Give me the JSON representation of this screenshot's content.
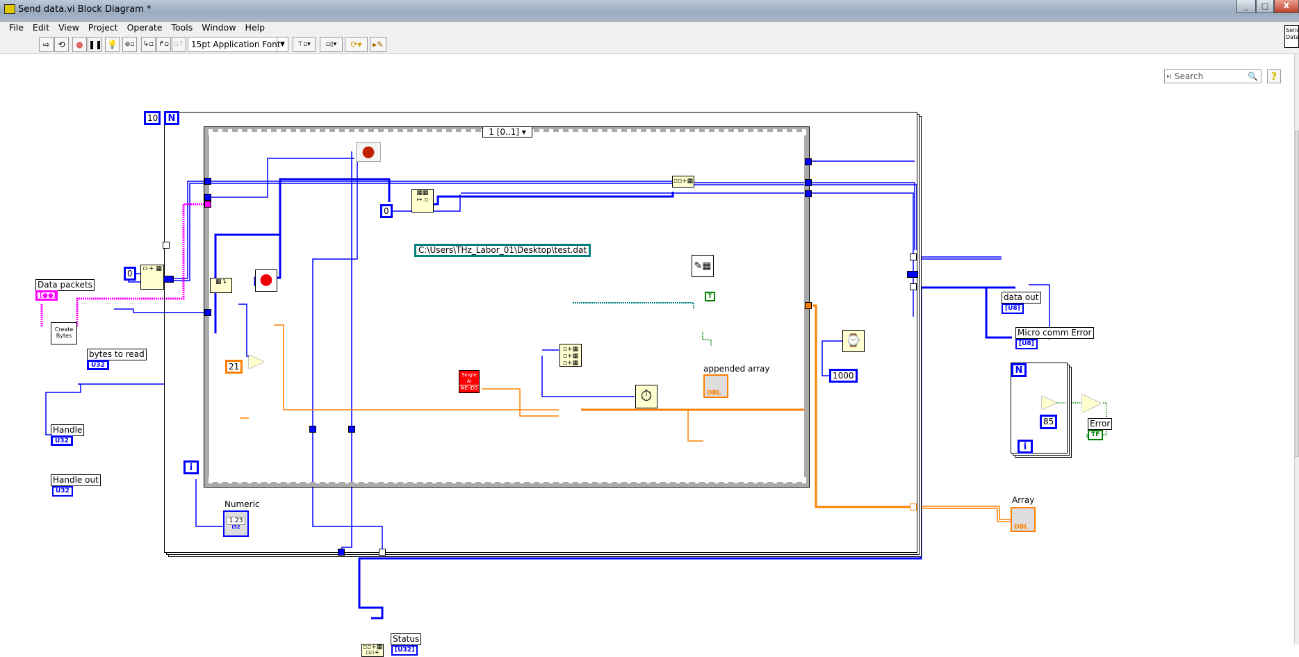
{
  "window": {
    "title": "Send data.vi Block Diagram *",
    "minimize": "_",
    "maximize": "□",
    "close": "X"
  },
  "menu": [
    "File",
    "Edit",
    "View",
    "Project",
    "Operate",
    "Tools",
    "Window",
    "Help"
  ],
  "toolbar": {
    "font": "15pt Application Font",
    "search_placeholder": "Search",
    "help": "?",
    "vi_icon_text": "Send Data"
  },
  "diagram": {
    "loop_count": "10",
    "loop_N": "N",
    "loop_i": "i",
    "sequence_selector": "1 [0..1]",
    "controls": {
      "data_packets": {
        "label": "Data packets",
        "type": "[●●]"
      },
      "bytes_to_read": {
        "label": "bytes to read",
        "type": "U32"
      },
      "handle": {
        "label": "Handle",
        "type": "U32"
      }
    },
    "indicators": {
      "handle_out": {
        "label": "Handle out",
        "type": "U32"
      },
      "numeric": {
        "label": "Numeric",
        "value": "1.23",
        "type": "I32"
      },
      "status": {
        "label": "Status",
        "type": "[U32]"
      },
      "data_out": {
        "label": "data out",
        "type": "[U8]"
      },
      "micro_comm_error": {
        "label": "Micro comm Error",
        "type": "[U8]"
      },
      "error": {
        "label": "Error",
        "type": "TF"
      },
      "appended_array": {
        "label": "appended array",
        "type": "DBL"
      },
      "array": {
        "label": "Array",
        "type": "DBL"
      }
    },
    "constants": {
      "zero_index": "0",
      "zero_inner": "0",
      "twenty_one": "21",
      "thousand": "1000",
      "eighty_five": "85",
      "true_const": "T",
      "file_path": "C:\\Users\\THz_Labor_01\\Desktop\\test.dat"
    },
    "subvis": {
      "create_bytes": "Create Bytes",
      "single_ai_line1": "Single",
      "single_ai_line2": "AI",
      "single_ai_line3": "ME-iDS"
    }
  },
  "colors": {
    "int_wire": "#0000ff",
    "dbl_wire": "#ff8000",
    "cluster_wire": "#ff00ff",
    "path_wire": "#008080",
    "bool_wire": "#008000"
  }
}
